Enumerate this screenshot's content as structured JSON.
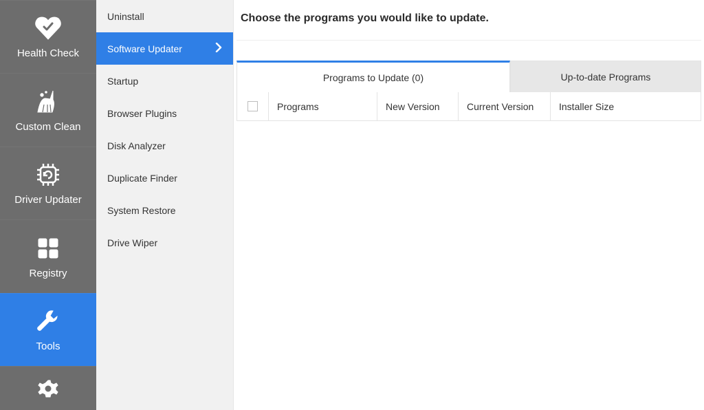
{
  "primary_nav": {
    "items": [
      {
        "label": "Health Check"
      },
      {
        "label": "Custom Clean"
      },
      {
        "label": "Driver Updater"
      },
      {
        "label": "Registry"
      },
      {
        "label": "Tools"
      }
    ]
  },
  "tools_nav": {
    "items": [
      {
        "label": "Uninstall"
      },
      {
        "label": "Software Updater"
      },
      {
        "label": "Startup"
      },
      {
        "label": "Browser Plugins"
      },
      {
        "label": "Disk Analyzer"
      },
      {
        "label": "Duplicate Finder"
      },
      {
        "label": "System Restore"
      },
      {
        "label": "Drive Wiper"
      }
    ]
  },
  "main": {
    "title": "Choose the programs you would like to update.",
    "tabs": {
      "active": "Programs to Update (0)",
      "inactive": "Up-to-date Programs"
    },
    "columns": {
      "programs": "Programs",
      "new_version": "New Version",
      "current_version": "Current Version",
      "installer_size": "Installer Size"
    }
  }
}
